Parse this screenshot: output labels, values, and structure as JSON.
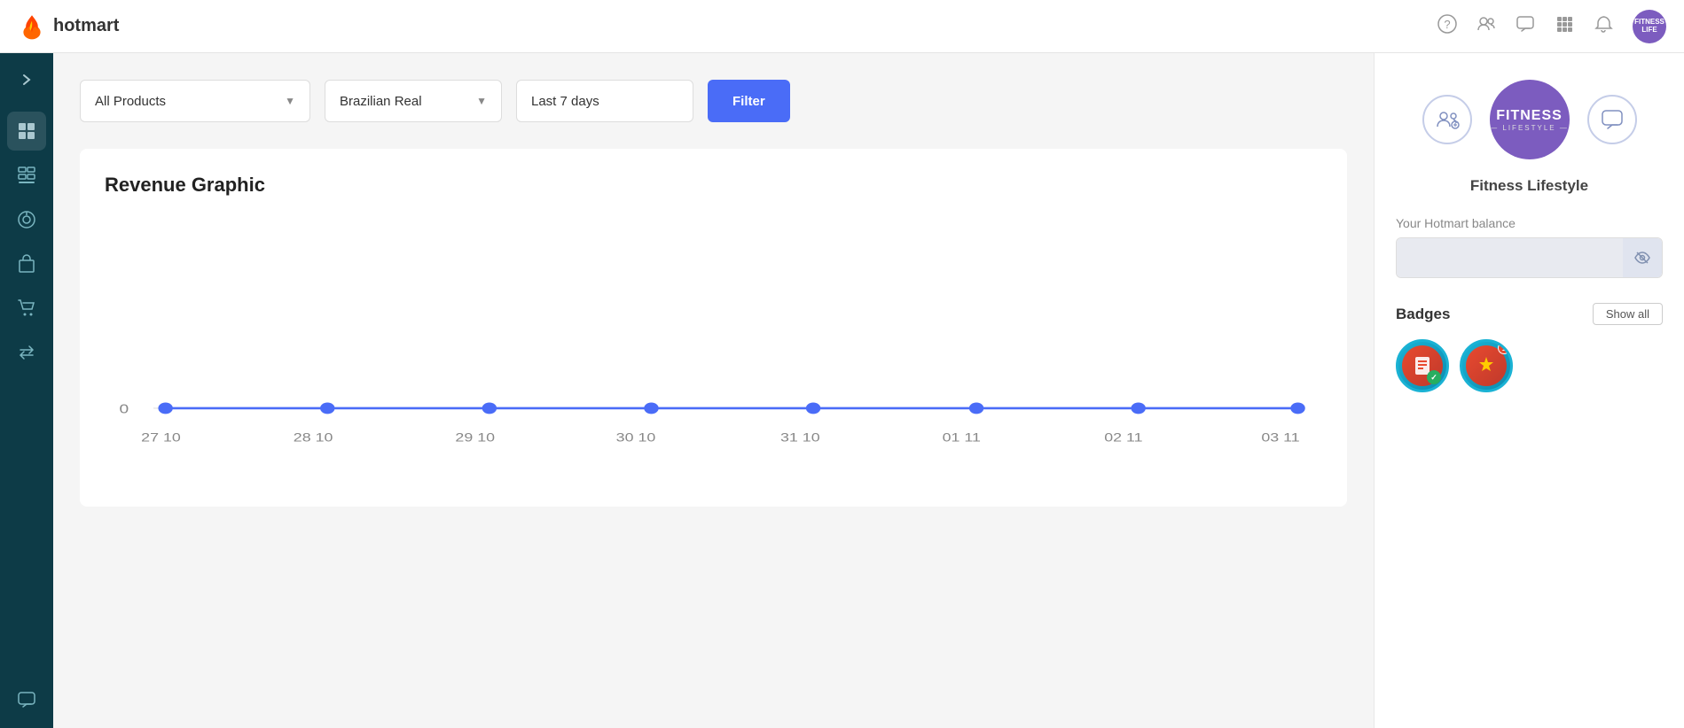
{
  "topnav": {
    "logo_text": "hotmart",
    "icons": [
      "help-icon",
      "user-group-icon",
      "chat-icon",
      "apps-grid-icon",
      "bell-icon"
    ],
    "avatar_text": "FITNESS\nLIFE"
  },
  "sidebar": {
    "toggle_label": "›",
    "items": [
      {
        "id": "dashboard",
        "label": "Dashboard",
        "icon": "⊞",
        "active": true
      },
      {
        "id": "products",
        "label": "Products",
        "icon": "▦"
      },
      {
        "id": "analytics",
        "label": "Analytics",
        "icon": "◎"
      },
      {
        "id": "box",
        "label": "Box",
        "icon": "◻"
      },
      {
        "id": "cart",
        "label": "Cart",
        "icon": "🛒"
      },
      {
        "id": "transfers",
        "label": "Transfers",
        "icon": "⇄"
      },
      {
        "id": "messages",
        "label": "Messages",
        "icon": "💬"
      }
    ]
  },
  "filters": {
    "products_label": "All Products",
    "products_placeholder": "All Products",
    "currency_label": "Brazilian Real",
    "currency_placeholder": "Brazilian Real",
    "date_label": "Last 7 days",
    "filter_button": "Filter"
  },
  "chart": {
    "title": "Revenue Graphic",
    "x_labels": [
      "27 10",
      "28 10",
      "29 10",
      "30 10",
      "31 10",
      "01 11",
      "02 11",
      "03 11"
    ],
    "y_labels": [
      "0"
    ],
    "data_points": [
      0,
      0,
      0,
      0,
      0,
      0,
      0,
      0
    ],
    "line_color": "#4a6cf7",
    "dot_color": "#4a6cf7"
  },
  "right_panel": {
    "product_name": "Fitness Lifestyle",
    "logo_line1": "FITNESS",
    "logo_line2": "— LIFESTYLE —",
    "balance_label": "Your Hotmart balance",
    "badges_title": "Badges",
    "show_all_label": "Show all",
    "badges": [
      {
        "id": "badge-1",
        "label": "Badge 1"
      },
      {
        "id": "badge-2",
        "label": "Badge 2"
      }
    ]
  }
}
